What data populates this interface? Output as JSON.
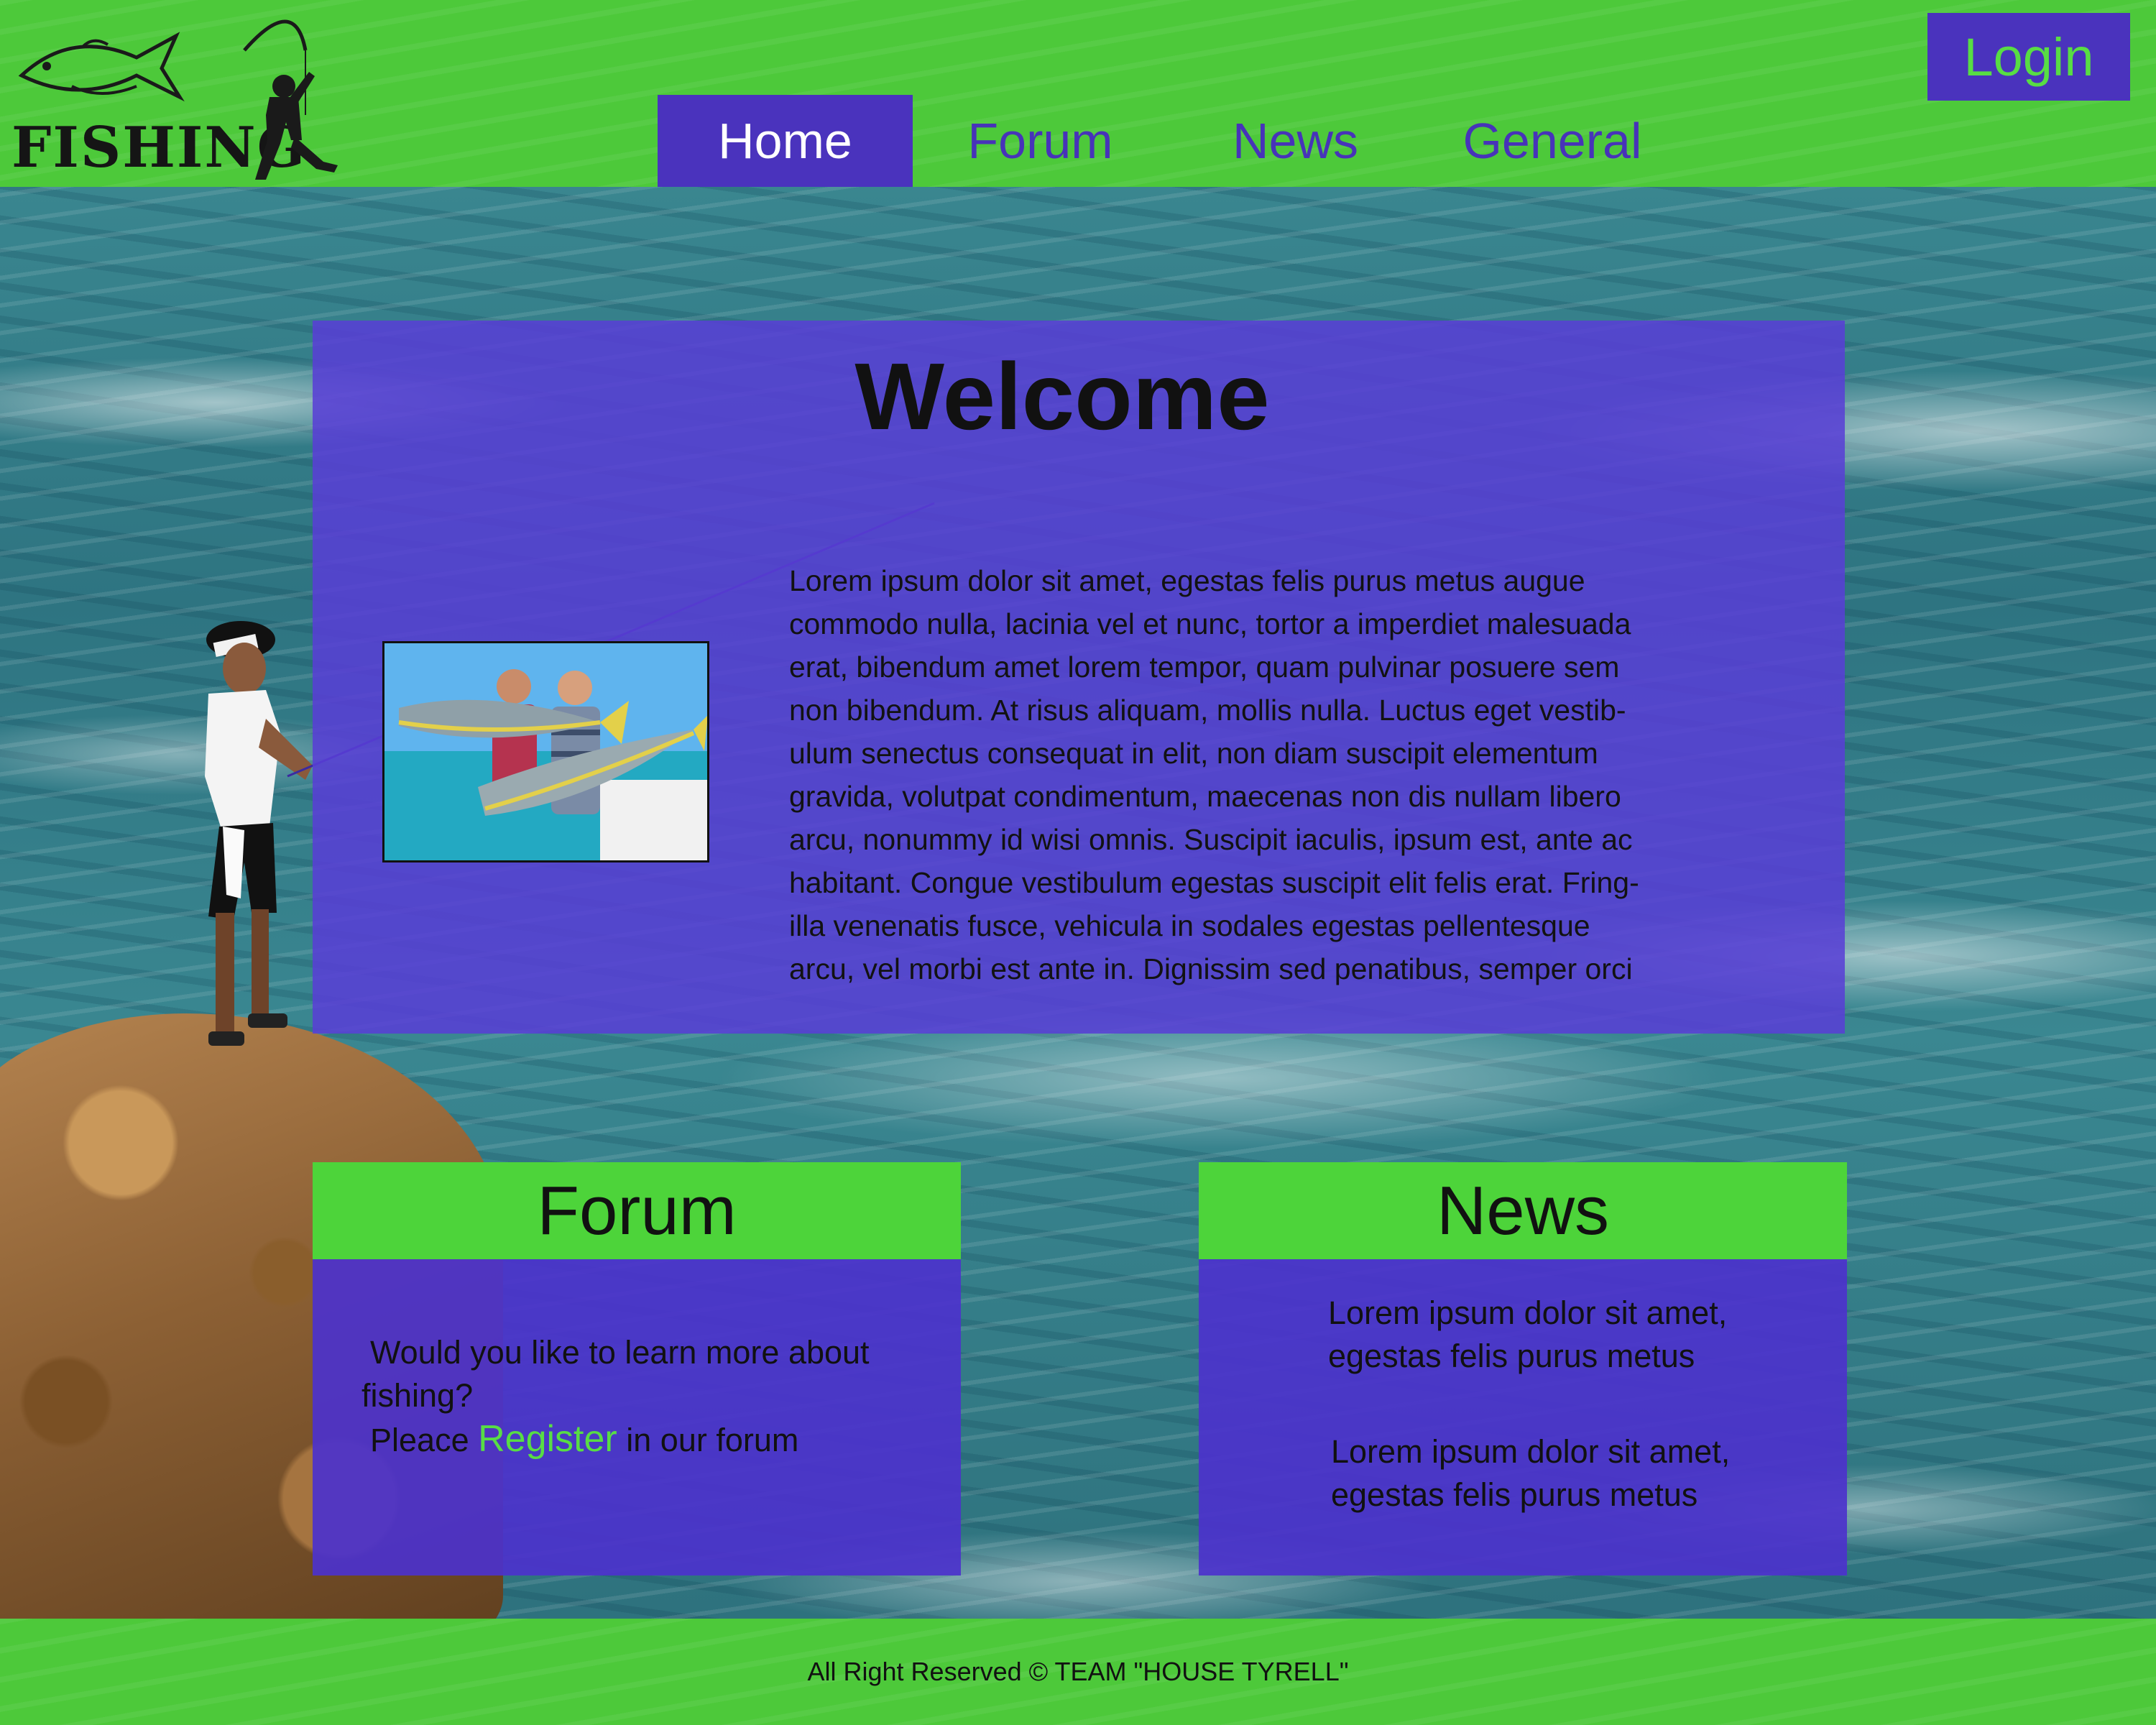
{
  "brand": {
    "name": "FISHING"
  },
  "nav": {
    "items": [
      {
        "label": "Home",
        "active": true
      },
      {
        "label": "Forum",
        "active": false
      },
      {
        "label": "News",
        "active": false
      },
      {
        "label": "General",
        "active": false
      }
    ]
  },
  "login": {
    "label": "Login"
  },
  "welcome": {
    "title": "Welcome",
    "lines": [
      "Lorem ipsum dolor sit amet, egestas felis purus metus augue",
      "commodo nulla, lacinia vel et nunc, tortor a imperdiet malesuada",
      "erat, bibendum amet lorem tempor, quam pulvinar posuere sem",
      "non bibendum. At risus aliquam, mollis nulla. Luctus eget vestib-",
      "ulum senectus consequat in elit, non diam suscipit elementum",
      "gravida, volutpat condimentum, maecenas non dis nullam libero",
      "arcu, nonummy id wisi omnis. Suscipit iaculis, ipsum est, ante ac",
      "habitant. Congue vestibulum egestas suscipit elit felis erat. Fring-",
      "illa venenatis fusce, vehicula in sodales egestas pellentesque",
      "arcu, vel morbi est ante in. Dignissim sed penatibus, semper orci"
    ]
  },
  "forum_card": {
    "title": "Forum",
    "line1": "Would you like to learn more about",
    "line2": "fishing?",
    "line3_before": "Pleace",
    "register_label": "Register",
    "line3_after": "in our  forum"
  },
  "news_card": {
    "title": "News",
    "item1_line1": "Lorem ipsum dolor sit amet,",
    "item1_line2": "egestas felis purus metus",
    "item2_line1": "Lorem ipsum dolor sit amet,",
    "item2_line2": "egestas felis purus metus"
  },
  "footer": {
    "text": "All Right Reserved ©  TEAM \"HOUSE TYRELL\""
  },
  "colors": {
    "header_green": "#4dc93a",
    "accent_purple": "#4a33bd",
    "link_green": "#58dd44"
  }
}
